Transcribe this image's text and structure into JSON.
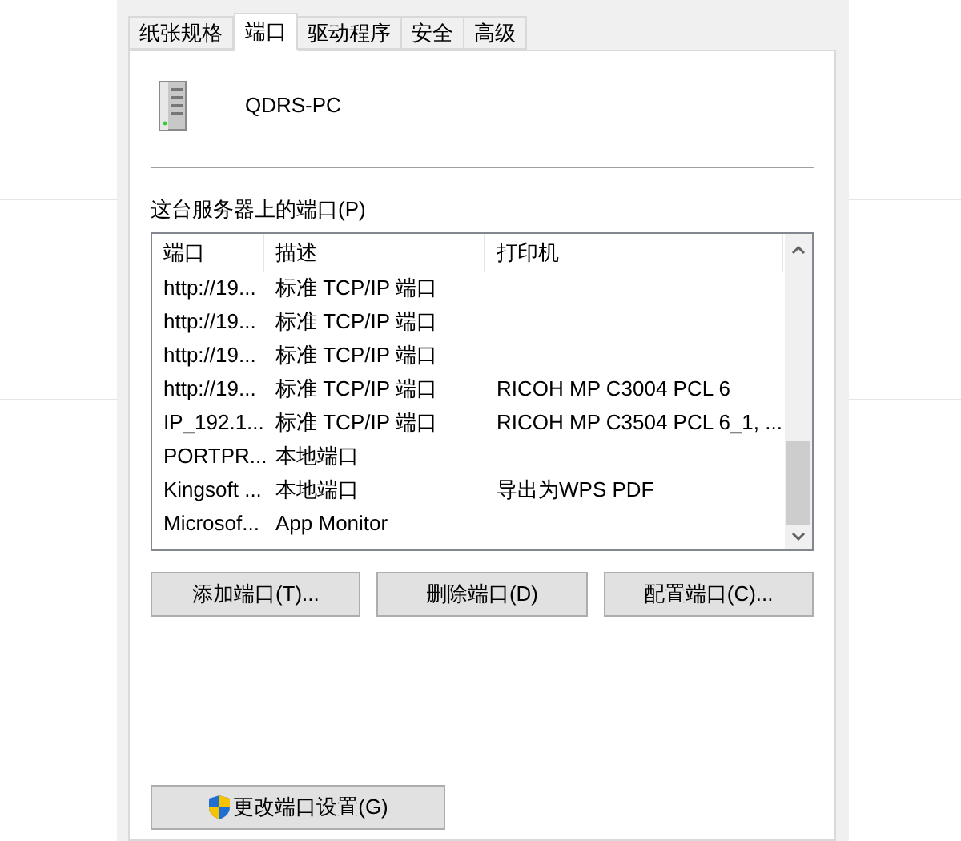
{
  "tabs": [
    {
      "label": "纸张规格",
      "selected": false
    },
    {
      "label": "端口",
      "selected": true
    },
    {
      "label": "驱动程序",
      "selected": false
    },
    {
      "label": "安全",
      "selected": false
    },
    {
      "label": "高级",
      "selected": false
    }
  ],
  "server_name": "QDRS-PC",
  "ports_label": "这台服务器上的端口(P)",
  "table": {
    "columns": [
      "端口",
      "描述",
      "打印机"
    ],
    "rows": [
      [
        "http://19...",
        "标准 TCP/IP 端口",
        ""
      ],
      [
        "http://19...",
        "标准 TCP/IP 端口",
        ""
      ],
      [
        "http://19...",
        "标准 TCP/IP 端口",
        ""
      ],
      [
        "http://19...",
        "标准 TCP/IP 端口",
        "RICOH MP C3004 PCL 6"
      ],
      [
        "IP_192.1...",
        "标准 TCP/IP 端口",
        "RICOH MP C3504 PCL 6_1, ..."
      ],
      [
        "PORTPR...",
        "本地端口",
        ""
      ],
      [
        "Kingsoft ...",
        "本地端口",
        "导出为WPS PDF"
      ],
      [
        "Microsof...",
        "App Monitor",
        ""
      ]
    ]
  },
  "buttons": [
    "添加端口(T)...",
    "删除端口(D)",
    "配置端口(C)..."
  ],
  "change_settings_button": "更改端口设置(G)"
}
